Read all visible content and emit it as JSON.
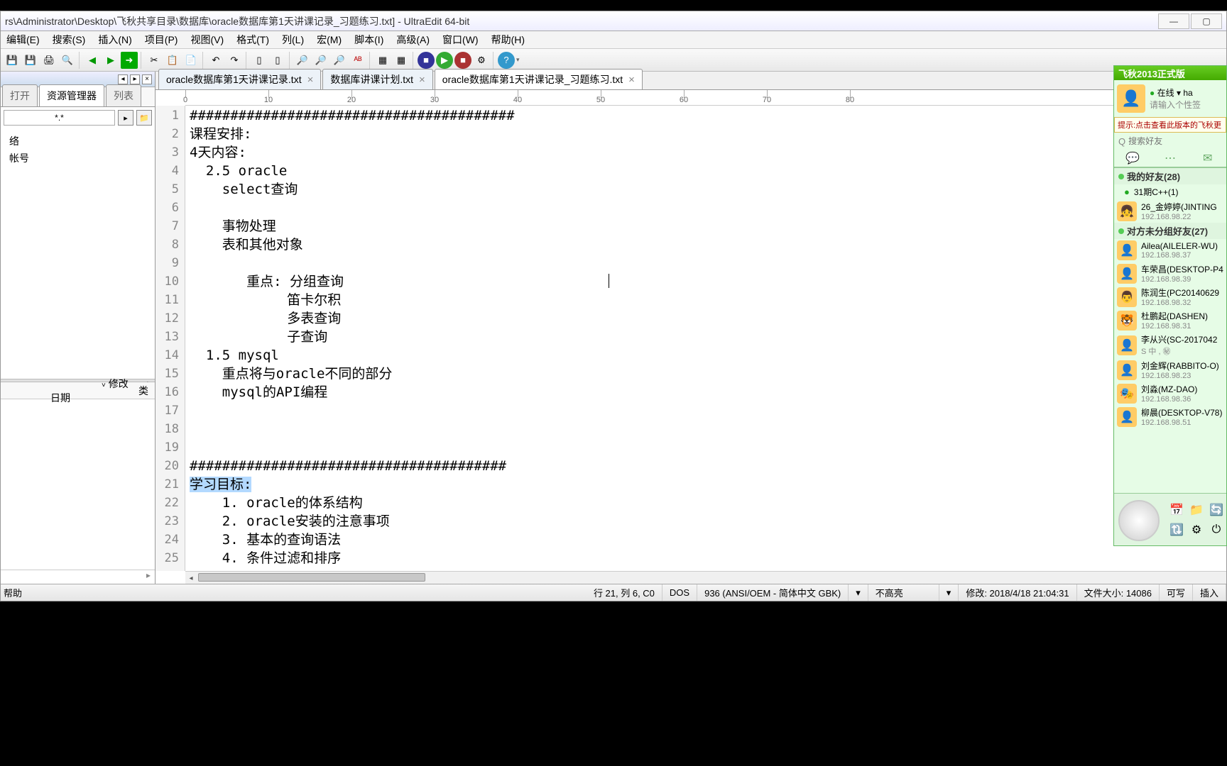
{
  "titlebar": {
    "path": "rs\\Administrator\\Desktop\\飞秋共享目录\\数据库\\oracle数据库第1天讲课记录_习题练习.txt] - UltraEdit 64-bit"
  },
  "menu": [
    "编辑(E)",
    "搜索(S)",
    "插入(N)",
    "项目(P)",
    "视图(V)",
    "格式(T)",
    "列(L)",
    "宏(M)",
    "脚本(I)",
    "高级(A)",
    "窗口(W)",
    "帮助(H)"
  ],
  "side": {
    "tab1": "打开",
    "tab2": "资源管理器",
    "tab3": "列表",
    "filter": "*.*",
    "tree": [
      "络",
      "  帐号"
    ],
    "colDate": "修改日期",
    "colType": "类"
  },
  "tabs": [
    {
      "label": "oracle数据库第1天讲课记录.txt",
      "active": false
    },
    {
      "label": "数据库讲课计划.txt",
      "active": false
    },
    {
      "label": "oracle数据库第1天讲课记录_习题练习.txt",
      "active": true
    }
  ],
  "ruler": [
    0,
    10,
    20,
    30,
    40,
    50,
    60,
    70,
    80
  ],
  "code": {
    "lines": [
      "########################################",
      "课程安排:",
      "4天内容:",
      "  2.5 oracle",
      "    select查询",
      "",
      "    事物处理",
      "    表和其他对象",
      "",
      "       重点: 分组查询",
      "            笛卡尔积",
      "            多表查询",
      "            子查询",
      "  1.5 mysql",
      "    重点将与oracle不同的部分",
      "    mysql的API编程",
      "",
      "",
      "",
      "#######################################",
      "学习目标:",
      "    1. oracle的体系结构",
      "    2. oracle安装的注意事项",
      "    3. 基本的查询语法",
      "    4. 条件过滤和排序"
    ],
    "highlightLine": 21
  },
  "status": {
    "help": "帮助",
    "pos": "行 21, 列 6, C0",
    "eol": "DOS",
    "enc": "936  (ANSI/OEM - 简体中文 GBK)",
    "hilite": "不高亮",
    "mod": "修改: 2018/4/18 21:04:31",
    "size": "文件大小: 14086",
    "write": "可写",
    "ins": "插入"
  },
  "feiqiu": {
    "title": "飞秋2013正式版",
    "status": "在线",
    "nick": "ha",
    "sign": "请输入个性签",
    "tip": "提示:点击查看此版本的飞秋更",
    "searchPlaceholder": "搜索好友",
    "group1": "我的好友(28)",
    "sub1": "31期C++(1)",
    "group2": "对方未分组好友(27)",
    "contacts": [
      {
        "name": "26_金婷婷(JINTING",
        "ip": "192.168.98.22",
        "av": "👧"
      },
      {
        "name": "Ailea(AILELER-WU)",
        "ip": "192.168.98.37",
        "av": "👤"
      },
      {
        "name": "车荣昌(DESKTOP-P4",
        "ip": "192.168.98.39",
        "av": "👤"
      },
      {
        "name": "陈润生(PC20140629",
        "ip": "192.168.98.32",
        "av": "👨"
      },
      {
        "name": "杜鹏起(DASHEN)",
        "ip": "192.168.98.31",
        "av": "🐯"
      },
      {
        "name": "李从兴(SC-2017042",
        "ip": "S 中 , ㊙",
        "av": "👤"
      },
      {
        "name": "刘金辉(RABBITO-O)",
        "ip": "192.168.98.23",
        "av": "👤"
      },
      {
        "name": "刘淼(MZ-DAO)",
        "ip": "192.168.98.36",
        "av": "🎭"
      },
      {
        "name": "柳晨(DESKTOP-V78)",
        "ip": "192.168.98.51",
        "av": "👤"
      }
    ]
  }
}
